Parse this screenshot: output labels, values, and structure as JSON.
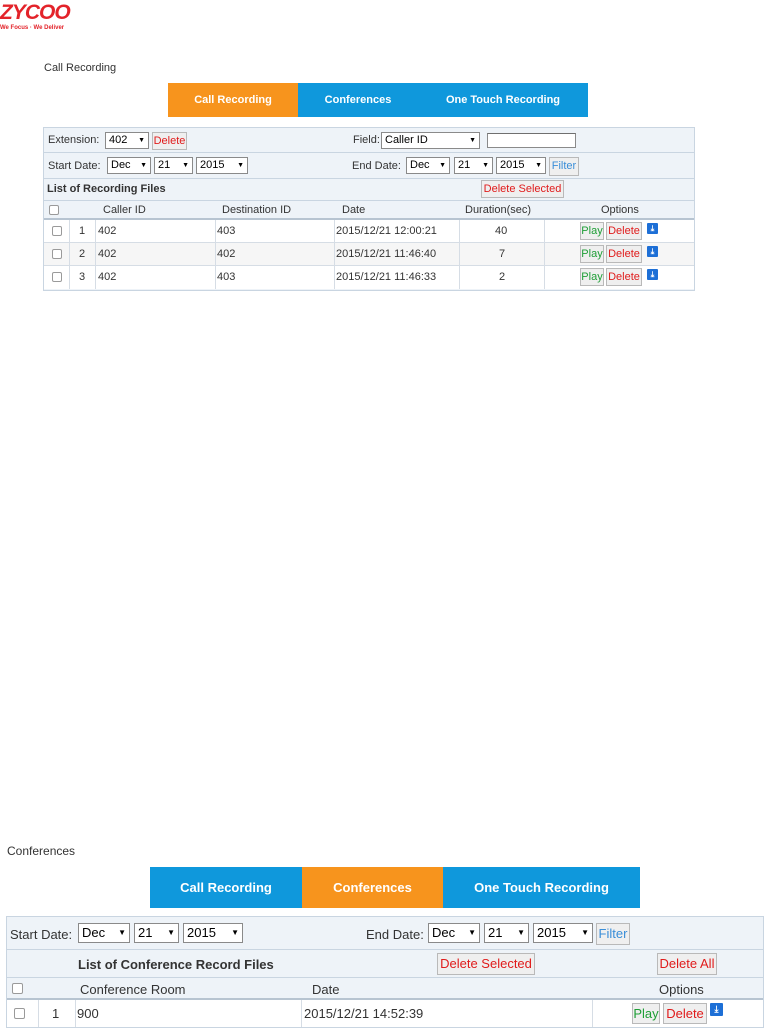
{
  "logo": {
    "mark": "ZYCOO",
    "tagline": "We Focus · We Deliver"
  },
  "section1": {
    "title": "Call Recording",
    "tabs": [
      {
        "label": "Call Recording",
        "active": true
      },
      {
        "label": "Conferences",
        "active": false
      },
      {
        "label": "One Touch Recording",
        "active": false
      }
    ],
    "filters": {
      "extension_label": "Extension:",
      "extension_value": "402",
      "delete_label": "Delete",
      "field_label": "Field:",
      "field_value": "Caller ID",
      "field_text": "",
      "start_date_label": "Start Date:",
      "end_date_label": "End Date:",
      "start_month": "Dec",
      "start_day": "21",
      "start_year": "2015",
      "end_month": "Dec",
      "end_day": "21",
      "end_year": "2015",
      "filter_label": "Filter"
    },
    "list_title": "List of Recording Files",
    "delete_selected_label": "Delete Selected",
    "columns": [
      "Caller ID",
      "Destination ID",
      "Date",
      "Duration(sec)",
      "Options"
    ],
    "rows": [
      {
        "index": "1",
        "caller": "402",
        "destination": "403",
        "date": "2015/12/21 12:00:21",
        "duration": "40"
      },
      {
        "index": "2",
        "caller": "402",
        "destination": "402",
        "date": "2015/12/21 11:46:40",
        "duration": "7"
      },
      {
        "index": "3",
        "caller": "402",
        "destination": "403",
        "date": "2015/12/21 11:46:33",
        "duration": "2"
      }
    ],
    "play_label": "Play",
    "row_delete_label": "Delete"
  },
  "section2": {
    "title": "Conferences",
    "tabs": [
      {
        "label": "Call Recording",
        "active": false
      },
      {
        "label": "Conferences",
        "active": true
      },
      {
        "label": "One Touch Recording",
        "active": false
      }
    ],
    "filters": {
      "start_date_label": "Start Date:",
      "end_date_label": "End Date:",
      "start_month": "Dec",
      "start_day": "21",
      "start_year": "2015",
      "end_month": "Dec",
      "end_day": "21",
      "end_year": "2015",
      "filter_label": "Filter"
    },
    "list_title": "List of Conference Record Files",
    "delete_selected_label": "Delete Selected",
    "delete_all_label": "Delete All",
    "columns": [
      "Conference Room",
      "Date",
      "Options"
    ],
    "rows": [
      {
        "index": "1",
        "room": "900",
        "date": "2015/12/21 14:52:39"
      }
    ],
    "play_label": "Play",
    "row_delete_label": "Delete"
  },
  "icons": {
    "caret": "▼",
    "download": "download-icon"
  },
  "colors": {
    "tab_blue": "#0f98dc",
    "tab_orange": "#f7941d",
    "logo_red": "#e3232a",
    "delete_red": "#e01b1b",
    "play_green": "#1e9e36",
    "filter_blue": "#3a8ed8"
  }
}
